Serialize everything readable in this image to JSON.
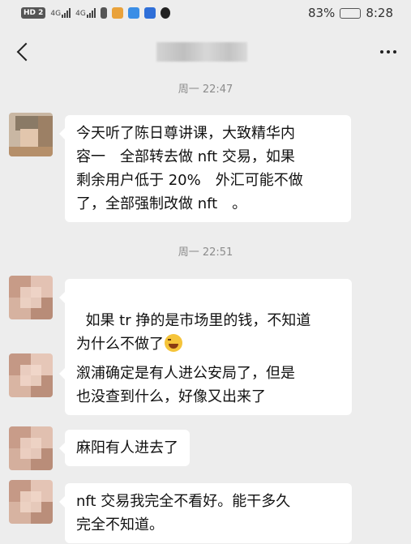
{
  "status_bar": {
    "left_chip": "HD 2",
    "net1": "4G",
    "net2": "4G",
    "battery_percent_text": "83%",
    "battery_level": 0.83,
    "time": "8:28"
  },
  "header": {
    "back_icon": "chevron-left-icon",
    "more_icon": "more-horizontal-icon",
    "title_obscured": true
  },
  "messages": [
    {
      "type": "time",
      "text": "周一 22:47"
    },
    {
      "type": "msg",
      "text": "今天听了陈日尊讲课，大致精华内\n容一　全部转去做 nft 交易，如果\n剩余用户低于 20%　外汇可能不做\n了，全部强制改做 nft　。"
    },
    {
      "type": "time",
      "text": "周一 22:51"
    },
    {
      "type": "msg",
      "text": "如果 tr 挣的是市场里的钱，不知道\n为什么不做了",
      "emoji": "grin-sweat-icon"
    },
    {
      "type": "msg",
      "text": "溆浦确定是有人进公安局了，但是\n也没查到什么，好像又出来了"
    },
    {
      "type": "msg",
      "text": "麻阳有人进去了"
    },
    {
      "type": "msg",
      "text": "nft 交易我完全不看好。能干多久\n完全不知道。"
    }
  ],
  "colors": {
    "background": "#ededed",
    "bubble": "#ffffff",
    "timestamp": "#8c8c8c"
  }
}
